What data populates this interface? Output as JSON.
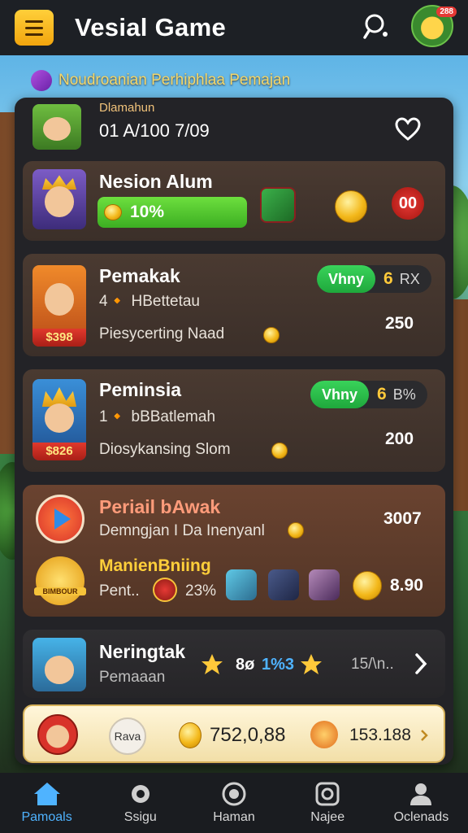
{
  "header": {
    "title": "Vesial Game",
    "menu_icon": "hamburger-menu-icon",
    "search_icon": "search-icon",
    "avatar_badge": "288"
  },
  "notice": {
    "text": "Noudroanian Perhiphlaa Pemajan"
  },
  "top_card": {
    "title": "Dlamahun",
    "time": "01 A/100 7/09",
    "heart_icon": "heart-outline-icon"
  },
  "cards": [
    {
      "name": "Nesion Alum",
      "progress_label": "10%",
      "progress_value": 0.1,
      "badge": "00"
    },
    {
      "name": "Pemakak",
      "sub1": "4🔸 HBettetau",
      "sub2": "Piesycerting Naad",
      "price": "$398",
      "action": "Vhny",
      "count": "6",
      "unit": "RX",
      "value": "250"
    },
    {
      "name": "Peminsia",
      "sub1": "1🔸 bBBatlemah",
      "sub2": "Diosykansing Slom",
      "price": "$826",
      "action": "Vhny",
      "count": "6",
      "unit": "B%",
      "value": "200"
    }
  ],
  "special_card": {
    "title": "Periail bAwak",
    "sub": "Demngjan I Da Inenyanl",
    "value": "3007",
    "medal_label": "BIMBOUR",
    "title2": "ManienBniing",
    "sub2": "Pent..",
    "percent": "23%",
    "coin_value": "8.90"
  },
  "list_card": {
    "name": "Neringtak",
    "sub": "Pemaaan",
    "stat_a": "8ø",
    "stat_b": "1%3",
    "stat_c": "15/\\n.."
  },
  "currency_bar": {
    "label": "Rava",
    "coins": "752,0,88",
    "gems": "153.188"
  },
  "nav": [
    {
      "label": "Pamoals",
      "icon": "home-icon",
      "active": true
    },
    {
      "label": "Ssigu",
      "icon": "badge-icon",
      "active": false
    },
    {
      "label": "Haman",
      "icon": "target-icon",
      "active": false
    },
    {
      "label": "Najee",
      "icon": "camera-icon",
      "active": false
    },
    {
      "label": "Oclenads",
      "icon": "user-icon",
      "active": false
    }
  ],
  "colors": {
    "accent_yellow": "#ffcf3a",
    "action_green": "#2fc14c",
    "nav_active": "#4fb3ff",
    "card_brown": "#4a3a31"
  }
}
